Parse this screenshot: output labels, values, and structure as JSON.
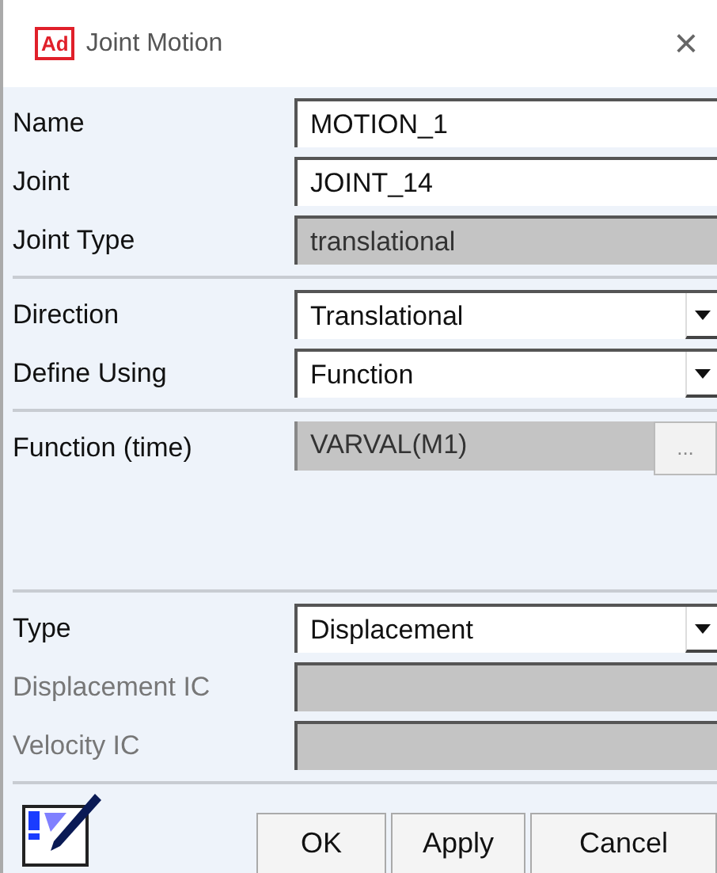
{
  "window": {
    "title": "Joint Motion",
    "logo": "Ad",
    "close": "×"
  },
  "sections": [
    {
      "rows": [
        {
          "label": "Name",
          "kind": "text",
          "value": "MOTION_1",
          "disabled": false
        },
        {
          "label": "Joint",
          "kind": "text",
          "value": "JOINT_14",
          "disabled": false
        },
        {
          "label": "Joint Type",
          "kind": "readonly",
          "value": "translational",
          "disabled": false
        }
      ]
    },
    {
      "rows": [
        {
          "label": "Direction",
          "kind": "select",
          "value": "Translational",
          "disabled": false
        },
        {
          "label": "Define Using",
          "kind": "select",
          "value": "Function",
          "disabled": false
        }
      ]
    },
    {
      "tall": true,
      "rows": [
        {
          "label": "Function (time)",
          "kind": "browse",
          "value": "VARVAL(M1)",
          "button": "...",
          "disabled": false
        }
      ]
    },
    {
      "rows": [
        {
          "label": "Type",
          "kind": "select",
          "value": "Displacement",
          "disabled": false
        },
        {
          "label": "Displacement IC",
          "kind": "readonly",
          "value": "",
          "disabled": true
        },
        {
          "label": "Velocity IC",
          "kind": "readonly",
          "value": "",
          "disabled": true
        }
      ]
    }
  ],
  "buttons": [
    "OK",
    "Apply",
    "Cancel"
  ]
}
